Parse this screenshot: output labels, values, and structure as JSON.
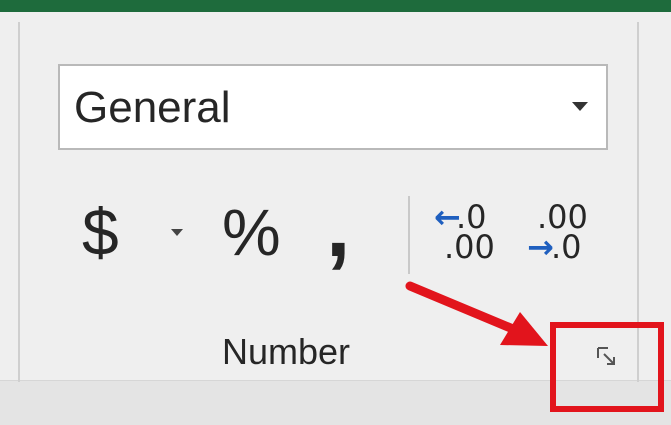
{
  "number_group": {
    "format_dropdown": {
      "value": "General"
    },
    "currency_button": {
      "symbol": "$"
    },
    "percent_button": {
      "symbol": "%"
    },
    "comma_button": {
      "symbol": ","
    },
    "increase_decimal": {
      "arrow": "←",
      "top": ".0",
      "bottom": ".00"
    },
    "decrease_decimal": {
      "arrow": "→",
      "top": ".00",
      "bottom": ".0"
    },
    "label": "Number",
    "launcher_icon": "dialog-launcher-icon"
  },
  "annotation": {
    "arrow_color": "#e2141c",
    "box_color": "#e2141c"
  }
}
